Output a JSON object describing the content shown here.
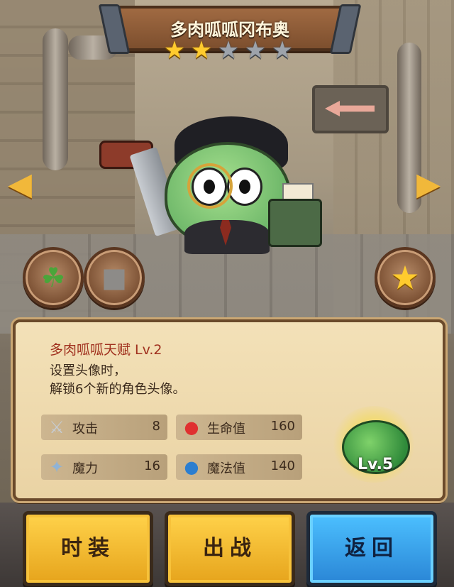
{
  "title": "多肉呱呱冈布奥",
  "stars": {
    "filled": 2,
    "total": 5
  },
  "talent": {
    "title": "多肉呱呱天赋 Lv.2",
    "desc_line1": "设置头像时，",
    "desc_line2": "解锁6个新的角色头像。"
  },
  "stats": [
    {
      "label": "攻击",
      "value": "8",
      "icon": "sword-icon"
    },
    {
      "label": "生命值",
      "value": "160",
      "icon": "red-potion-icon"
    },
    {
      "label": "魔力",
      "value": "16",
      "icon": "wand-icon"
    },
    {
      "label": "魔法值",
      "value": "140",
      "icon": "blue-potion-icon"
    }
  ],
  "badge_level": "Lv.5",
  "buttons": {
    "costume": "时装",
    "battle": "出战",
    "back": "返回"
  },
  "icons": {
    "left_circle_1": "lotus-leaf-icon",
    "left_circle_2": "stone-icon",
    "right_circle": "star-icon"
  },
  "colors": {
    "accent_yellow": "#ffcb2e",
    "button_blue": "#2a86d6",
    "talent_red": "#a0301e"
  }
}
